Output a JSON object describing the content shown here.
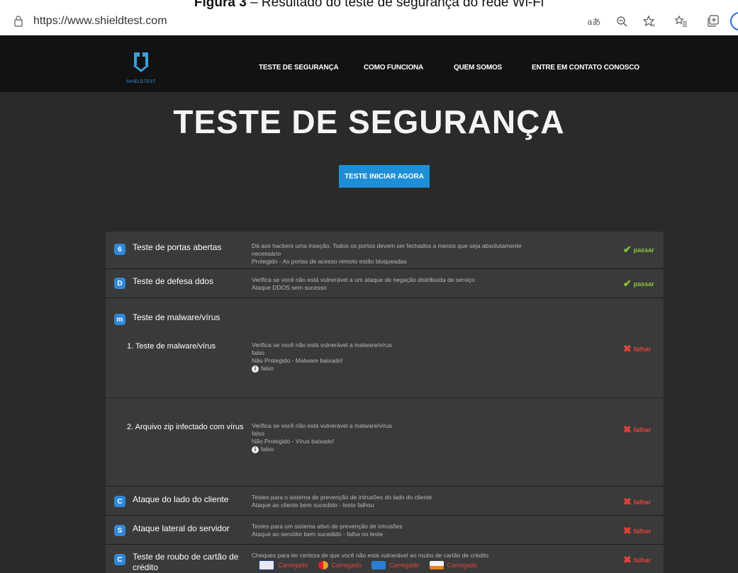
{
  "caption": {
    "bold": "Figura 3",
    "text": " – Resultado do teste de segurança do rede Wi-Fi"
  },
  "browser": {
    "url": "https://www.shieldtest.com",
    "icons": [
      "lock-icon",
      "read-aloud-icon",
      "zoom-out-icon",
      "favorite-icon",
      "favorites-list-icon",
      "collections-icon",
      "profile-icon"
    ]
  },
  "site": {
    "logo_text": "SHIELDTEST",
    "nav": [
      "TESTE DE SEGURANÇA",
      "COMO FUNCIONA",
      "QUEM SOMOS",
      "ENTRE EM CONTATO CONOSCO"
    ],
    "title": "TESTE DE SEGURANÇA",
    "cta": "TESTE INICIAR AGORA"
  },
  "tests": [
    {
      "badge": "6",
      "name": "Teste de portas abertas",
      "desc": [
        "Dá aos hackers uma inseção. Todos os portos devem ser fechados a menos que seja absolutamente",
        "necessário",
        "Protegido - As portas de acesso remoto estão bloqueadas"
      ],
      "status": "passar",
      "result": "pass"
    },
    {
      "badge": "D",
      "name": "Teste de defesa ddos",
      "desc": [
        "Verifica se você não está vulnerável a um ataque de negação distribuída de serviço",
        "Ataque DDOS sem sucesso"
      ],
      "status": "passar",
      "result": "pass"
    },
    {
      "badge": "m",
      "name": "Teste de malware/vírus",
      "desc": [],
      "status": "",
      "result": "none"
    },
    {
      "badge": "",
      "name": "1. Teste de malware/vírus",
      "desc": [
        "Verifica se você não está vulnerável a malware/vírus",
        "falso",
        "Não Protegido - Malware baixado!"
      ],
      "info": "falso",
      "status": "falhar",
      "result": "fail"
    },
    {
      "badge": "",
      "name": "2. Arquivo zip infectado com vírus",
      "desc": [
        "Verifica se você não está vulnerável a malware/vírus",
        "falso",
        "Não Protegido - Vírus baixado!"
      ],
      "info": "falso",
      "status": "falhar",
      "result": "fail"
    },
    {
      "badge": "C",
      "name": "Ataque do lado do cliente",
      "desc": [
        "Testes para o sistema de prevenção de intrusões do lado do cliente",
        "Ataque ao cliente bem sucedido - teste falhou"
      ],
      "status": "falhar",
      "result": "fail"
    },
    {
      "badge": "S",
      "name": "Ataque lateral do servidor",
      "desc": [
        "Testes para um sistema ativo de prevenção de intrusões",
        "Ataque ao servidor bem sucedido - falha no teste"
      ],
      "status": "falhar",
      "result": "fail"
    },
    {
      "badge": "C",
      "name": "Teste de roubo de cartão de crédito",
      "desc": [
        "Cheques para ter certeza de que você não está vulnerável ao roubo de cartão de crédito"
      ],
      "status": "falhar",
      "result": "fail",
      "cards": [
        {
          "brand": "visa",
          "label": "Carregado"
        },
        {
          "brand": "mastercard",
          "label": "Carregado"
        },
        {
          "brand": "amex",
          "label": "Carregado"
        },
        {
          "brand": "discover",
          "label": "Carregado"
        }
      ]
    }
  ],
  "colors": {
    "accent": "#1e8fd6",
    "pass": "#8ac83c",
    "fail": "#e0443a",
    "page_bg": "#2a2a2a",
    "nav_bg": "#121212"
  }
}
